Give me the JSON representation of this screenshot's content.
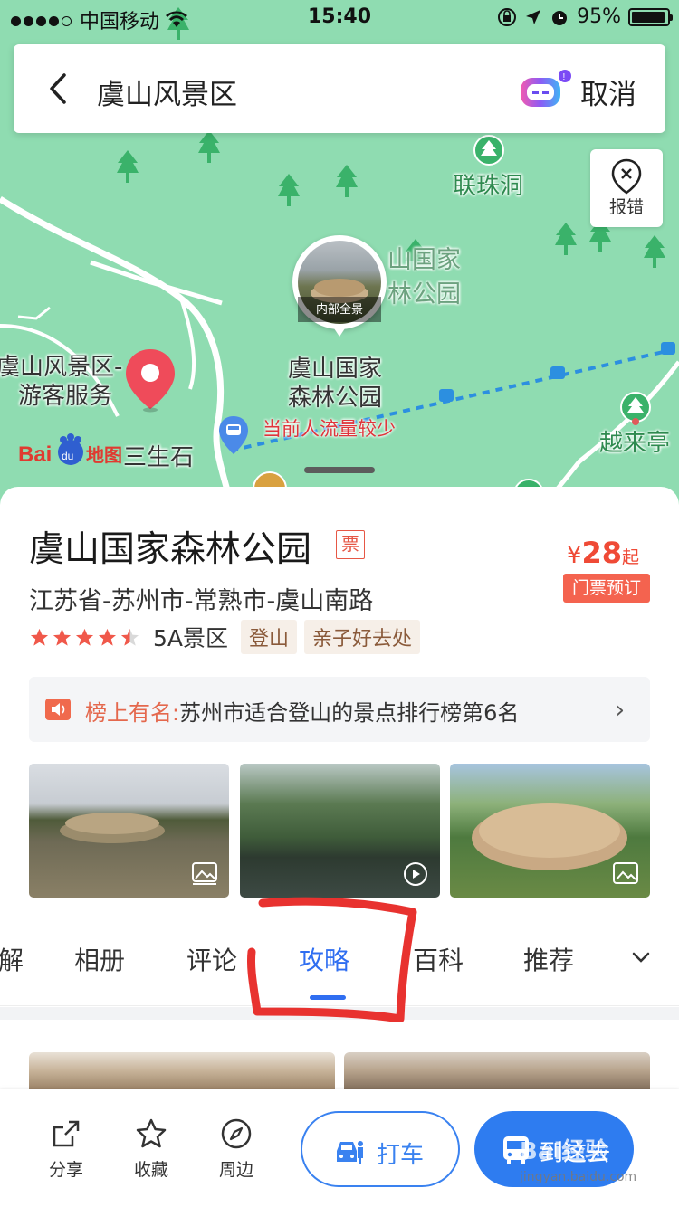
{
  "status_bar": {
    "carrier": "中国移动",
    "time": "15:40",
    "battery": "95%",
    "battery_level": 0.95
  },
  "search": {
    "query": "虞山风景区",
    "cancel_label": "取消"
  },
  "map": {
    "report_label": "报错",
    "pano_label": "内部全景",
    "labels": {
      "lianzhu": "联珠洞",
      "park_faded_1": "山国家",
      "park_faded_2": "林公园",
      "park_1": "虞山国家",
      "park_2": "森林公园",
      "crowd": "当前人流量较少",
      "visitor_1": "虞山风景区-",
      "visitor_2": "游客服务",
      "sansheng": "三生石",
      "yuelai": "越来亭"
    },
    "logo_text": "Bai地图"
  },
  "poi": {
    "name": "虞山国家森林公园",
    "ticket_tag": "票",
    "price_currency": "¥",
    "price": "28",
    "price_suffix": "起",
    "book_label": "门票预订",
    "address": "江苏省-苏州市-常熟市-虞山南路",
    "rating": 4.5,
    "level": "5A景区",
    "tags": [
      "登山",
      "亲子好去处"
    ],
    "rank_prefix": "榜上有名:",
    "rank_text": "苏州市适合登山的景点排行榜第6名"
  },
  "tabs": {
    "items": [
      "解",
      "相册",
      "评论",
      "攻略",
      "百科",
      "推荐"
    ],
    "active": "攻略"
  },
  "bottom_bar": {
    "share": "分享",
    "favorite": "收藏",
    "nearby": "周边",
    "taxi": "打车",
    "go": "到这去"
  },
  "watermark": {
    "brand": "Bai经验",
    "url": "jingyan.baidu.com"
  },
  "colors": {
    "accent": "#2f6ef1",
    "price": "#ef4a36",
    "map_green": "#8fdcb1",
    "annotation": "#e8322f"
  }
}
